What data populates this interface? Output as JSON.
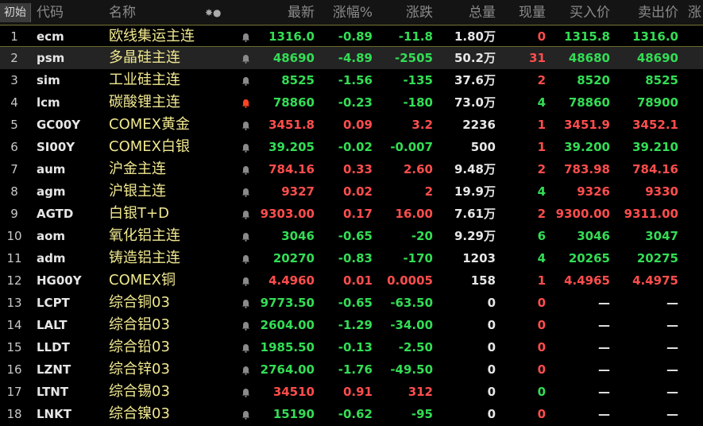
{
  "corner_label": "初始",
  "header": {
    "code": "代码",
    "name": "名称",
    "icons": "✸●",
    "last": "最新",
    "pct": "涨幅%",
    "chg": "涨跌",
    "vol": "总量",
    "cur": "现量",
    "bid": "买入价",
    "ask": "卖出价",
    "extra": "涨"
  },
  "colors": {
    "up": "#ff4d4d",
    "down": "#33dd55",
    "name": "#f0e890",
    "bell_active": "#ff4422",
    "bell_inactive": "#8a8a8a"
  },
  "rows": [
    {
      "idx": "1",
      "code": "ecm",
      "name": "欧线集运主连",
      "bell": "inactive",
      "last": "1316.0",
      "pct": "-0.89",
      "chg": "-11.8",
      "vol": "1.80万",
      "cur": "0",
      "bid": "1315.8",
      "ask": "1316.0",
      "last_c": "down",
      "pct_c": "down",
      "chg_c": "down",
      "cur_c": "up",
      "bid_c": "down",
      "ask_c": "down"
    },
    {
      "idx": "2",
      "code": "psm",
      "name": "多晶硅主连",
      "bell": "inactive",
      "last": "48690",
      "pct": "-4.89",
      "chg": "-2505",
      "vol": "50.2万",
      "cur": "31",
      "bid": "48680",
      "ask": "48690",
      "last_c": "down",
      "pct_c": "down",
      "chg_c": "down",
      "cur_c": "up",
      "bid_c": "down",
      "ask_c": "down"
    },
    {
      "idx": "3",
      "code": "sim",
      "name": "工业硅主连",
      "bell": "inactive",
      "last": "8525",
      "pct": "-1.56",
      "chg": "-135",
      "vol": "37.6万",
      "cur": "2",
      "bid": "8520",
      "ask": "8525",
      "last_c": "down",
      "pct_c": "down",
      "chg_c": "down",
      "cur_c": "up",
      "bid_c": "down",
      "ask_c": "down"
    },
    {
      "idx": "4",
      "code": "lcm",
      "name": "碳酸锂主连",
      "bell": "active",
      "last": "78860",
      "pct": "-0.23",
      "chg": "-180",
      "vol": "73.0万",
      "cur": "4",
      "bid": "78860",
      "ask": "78900",
      "last_c": "down",
      "pct_c": "down",
      "chg_c": "down",
      "cur_c": "down",
      "bid_c": "down",
      "ask_c": "down"
    },
    {
      "idx": "5",
      "code": "GC00Y",
      "name": "COMEX黄金",
      "bell": "inactive",
      "last": "3451.8",
      "pct": "0.09",
      "chg": "3.2",
      "vol": "2236",
      "cur": "1",
      "bid": "3451.9",
      "ask": "3452.1",
      "last_c": "up",
      "pct_c": "up",
      "chg_c": "up",
      "cur_c": "up",
      "bid_c": "up",
      "ask_c": "up"
    },
    {
      "idx": "6",
      "code": "SI00Y",
      "name": "COMEX白银",
      "bell": "inactive",
      "last": "39.205",
      "pct": "-0.02",
      "chg": "-0.007",
      "vol": "500",
      "cur": "1",
      "bid": "39.200",
      "ask": "39.210",
      "last_c": "down",
      "pct_c": "down",
      "chg_c": "down",
      "cur_c": "up",
      "bid_c": "down",
      "ask_c": "down"
    },
    {
      "idx": "7",
      "code": "aum",
      "name": "沪金主连",
      "bell": "inactive",
      "last": "784.16",
      "pct": "0.33",
      "chg": "2.60",
      "vol": "9.48万",
      "cur": "2",
      "bid": "783.98",
      "ask": "784.16",
      "last_c": "up",
      "pct_c": "up",
      "chg_c": "up",
      "cur_c": "up",
      "bid_c": "up",
      "ask_c": "up"
    },
    {
      "idx": "8",
      "code": "agm",
      "name": "沪银主连",
      "bell": "inactive",
      "last": "9327",
      "pct": "0.02",
      "chg": "2",
      "vol": "19.9万",
      "cur": "4",
      "bid": "9326",
      "ask": "9330",
      "last_c": "up",
      "pct_c": "up",
      "chg_c": "up",
      "cur_c": "down",
      "bid_c": "up",
      "ask_c": "up"
    },
    {
      "idx": "9",
      "code": "AGTD",
      "name": "白银T+D",
      "bell": "inactive",
      "last": "9303.00",
      "pct": "0.17",
      "chg": "16.00",
      "vol": "7.61万",
      "cur": "2",
      "bid": "9300.00",
      "ask": "9311.00",
      "last_c": "up",
      "pct_c": "up",
      "chg_c": "up",
      "cur_c": "up",
      "bid_c": "up",
      "ask_c": "up"
    },
    {
      "idx": "10",
      "code": "aom",
      "name": "氧化铝主连",
      "bell": "inactive",
      "last": "3046",
      "pct": "-0.65",
      "chg": "-20",
      "vol": "9.29万",
      "cur": "6",
      "bid": "3046",
      "ask": "3047",
      "last_c": "down",
      "pct_c": "down",
      "chg_c": "down",
      "cur_c": "down",
      "bid_c": "down",
      "ask_c": "down"
    },
    {
      "idx": "11",
      "code": "adm",
      "name": "铸造铝主连",
      "bell": "inactive",
      "last": "20270",
      "pct": "-0.83",
      "chg": "-170",
      "vol": "1203",
      "cur": "4",
      "bid": "20265",
      "ask": "20275",
      "last_c": "down",
      "pct_c": "down",
      "chg_c": "down",
      "cur_c": "down",
      "bid_c": "down",
      "ask_c": "down"
    },
    {
      "idx": "12",
      "code": "HG00Y",
      "name": "COMEX铜",
      "bell": "inactive",
      "last": "4.4960",
      "pct": "0.01",
      "chg": "0.0005",
      "vol": "158",
      "cur": "1",
      "bid": "4.4965",
      "ask": "4.4975",
      "last_c": "up",
      "pct_c": "up",
      "chg_c": "up",
      "cur_c": "up",
      "bid_c": "up",
      "ask_c": "up"
    },
    {
      "idx": "13",
      "code": "LCPT",
      "name": "综合铜03",
      "bell": "inactive",
      "last": "9773.50",
      "pct": "-0.65",
      "chg": "-63.50",
      "vol": "0",
      "cur": "0",
      "bid": "—",
      "ask": "—",
      "last_c": "down",
      "pct_c": "down",
      "chg_c": "down",
      "cur_c": "up",
      "bid_c": "flat",
      "ask_c": "flat"
    },
    {
      "idx": "14",
      "code": "LALT",
      "name": "综合铝03",
      "bell": "inactive",
      "last": "2604.00",
      "pct": "-1.29",
      "chg": "-34.00",
      "vol": "0",
      "cur": "0",
      "bid": "—",
      "ask": "—",
      "last_c": "down",
      "pct_c": "down",
      "chg_c": "down",
      "cur_c": "up",
      "bid_c": "flat",
      "ask_c": "flat"
    },
    {
      "idx": "15",
      "code": "LLDT",
      "name": "综合铅03",
      "bell": "inactive",
      "last": "1985.50",
      "pct": "-0.13",
      "chg": "-2.50",
      "vol": "0",
      "cur": "0",
      "bid": "—",
      "ask": "—",
      "last_c": "down",
      "pct_c": "down",
      "chg_c": "down",
      "cur_c": "up",
      "bid_c": "flat",
      "ask_c": "flat"
    },
    {
      "idx": "16",
      "code": "LZNT",
      "name": "综合锌03",
      "bell": "inactive",
      "last": "2764.00",
      "pct": "-1.76",
      "chg": "-49.50",
      "vol": "0",
      "cur": "0",
      "bid": "—",
      "ask": "—",
      "last_c": "down",
      "pct_c": "down",
      "chg_c": "down",
      "cur_c": "up",
      "bid_c": "flat",
      "ask_c": "flat"
    },
    {
      "idx": "17",
      "code": "LTNT",
      "name": "综合锡03",
      "bell": "inactive",
      "last": "34510",
      "pct": "0.91",
      "chg": "312",
      "vol": "0",
      "cur": "0",
      "bid": "—",
      "ask": "—",
      "last_c": "up",
      "pct_c": "up",
      "chg_c": "up",
      "cur_c": "down",
      "bid_c": "flat",
      "ask_c": "flat"
    },
    {
      "idx": "18",
      "code": "LNKT",
      "name": "综合镍03",
      "bell": "inactive",
      "last": "15190",
      "pct": "-0.62",
      "chg": "-95",
      "vol": "0",
      "cur": "0",
      "bid": "—",
      "ask": "—",
      "last_c": "down",
      "pct_c": "down",
      "chg_c": "down",
      "cur_c": "up",
      "bid_c": "flat",
      "ask_c": "flat"
    }
  ]
}
